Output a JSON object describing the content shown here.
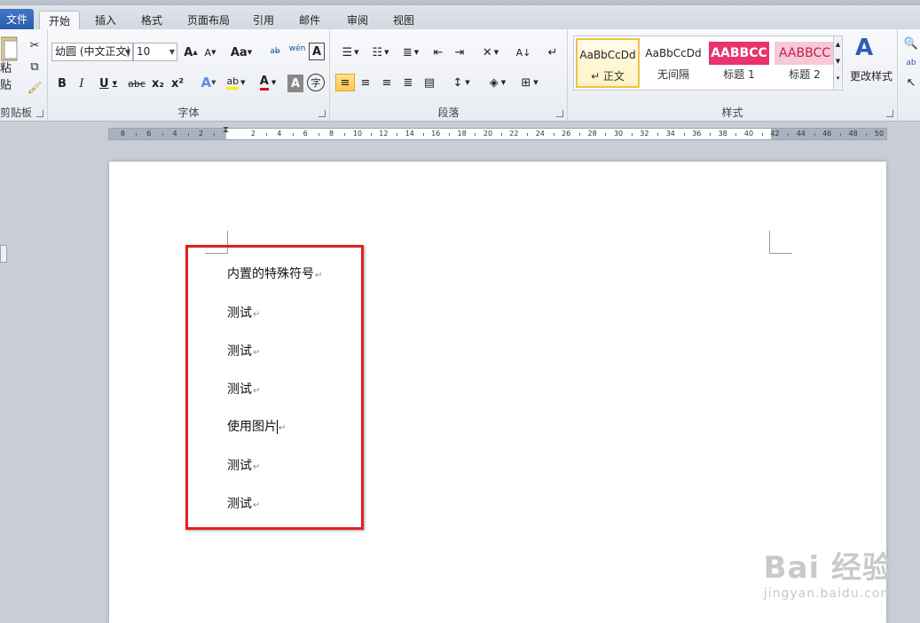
{
  "tabs": [
    {
      "label": "文件"
    },
    {
      "label": "开始"
    },
    {
      "label": "插入"
    },
    {
      "label": "格式"
    },
    {
      "label": "页面布局"
    },
    {
      "label": "引用"
    },
    {
      "label": "邮件"
    },
    {
      "label": "审阅"
    },
    {
      "label": "视图"
    }
  ],
  "clipboard": {
    "paste_label": "粘贴",
    "group_label": "剪贴板"
  },
  "font": {
    "name_value": "幼圆 (中文正文)",
    "size_value": "10",
    "group_label": "字体",
    "bold": "B",
    "italic": "I",
    "underline": "U",
    "strike": "abc",
    "subscript": "x₂",
    "superscript": "x²",
    "change_case": "Aa",
    "grow": "A",
    "shrink": "A",
    "font_color": "A",
    "char_shade": "A",
    "enclose": "字",
    "wen": "wén"
  },
  "paragraph": {
    "group_label": "段落"
  },
  "styles": {
    "group_label": "样式",
    "items": [
      {
        "sample": "AaBbCcDd",
        "name": "↵ 正文"
      },
      {
        "sample": "AaBbCcDd",
        "name": "无间隔"
      },
      {
        "sample": "AABBCC",
        "name": "标题 1"
      },
      {
        "sample": "AABBCC",
        "name": "标题 2"
      }
    ],
    "change_styles": "更改样式"
  },
  "ruler": {
    "labels": [
      "8",
      "6",
      "4",
      "2",
      "2",
      "4",
      "6",
      "8",
      "10",
      "12",
      "14",
      "16",
      "18",
      "20",
      "22",
      "24",
      "26",
      "28",
      "30",
      "32",
      "34",
      "36",
      "38",
      "40",
      "42",
      "44",
      "46",
      "48",
      "50"
    ]
  },
  "document": {
    "lines": [
      {
        "text": "内置的特殊符号"
      },
      {
        "text": "测试"
      },
      {
        "text": "测试"
      },
      {
        "text": "测试"
      },
      {
        "text": "使用图片"
      },
      {
        "text": "测试"
      },
      {
        "text": "测试"
      }
    ],
    "pilcrow": "↵"
  },
  "watermark": {
    "brand": "Bai 经验",
    "url": "jingyan.baidu.com"
  },
  "colors": {
    "file_tab": "#2f63b3",
    "highlight_box": "#e02020",
    "heading1": "#e8336d",
    "heading2": "#f6c9d7"
  }
}
